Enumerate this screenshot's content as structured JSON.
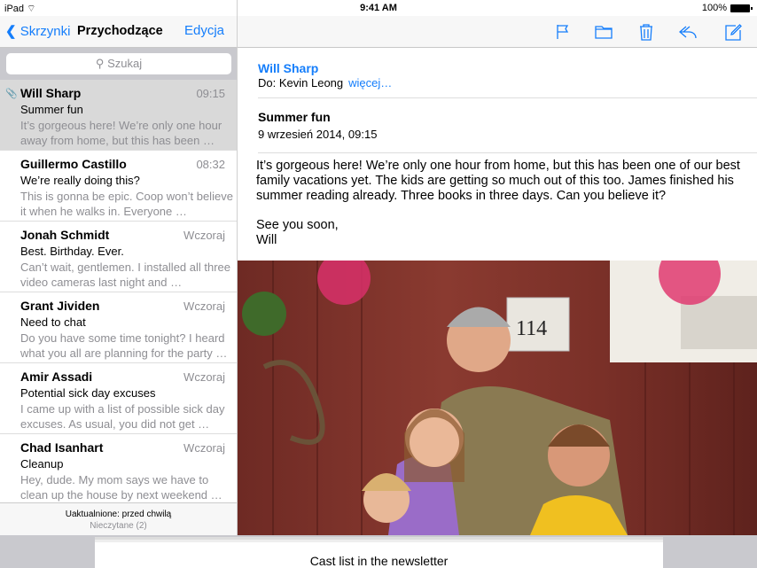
{
  "status": {
    "device": "iPad",
    "time": "9:41 AM",
    "battery": "100%"
  },
  "list": {
    "back_label": "Skrzynki",
    "title": "Przychodzące",
    "edit_label": "Edycja",
    "search_placeholder": "Szukaj",
    "messages": [
      {
        "from": "Will Sharp",
        "time": "09:15",
        "subject": "Summer fun",
        "preview": "It’s gorgeous here! We’re only one hour away from home, but this has been …",
        "attachment": true,
        "selected": true
      },
      {
        "from": "Guillermo Castillo",
        "time": "08:32",
        "subject": "We’re really doing this?",
        "preview": "This is gonna be epic. Coop won’t believe it when he walks in. Everyone …"
      },
      {
        "from": "Jonah Schmidt",
        "time": "Wczoraj",
        "subject": "Best. Birthday. Ever.",
        "preview": "Can’t wait, gentlemen. I installed all three video cameras last night and …"
      },
      {
        "from": "Grant Jividen",
        "time": "Wczoraj",
        "subject": "Need to chat",
        "preview": "Do you have some time tonight? I heard what you all are planning for the party …"
      },
      {
        "from": "Amir Assadi",
        "time": "Wczoraj",
        "subject": "Potential sick day excuses",
        "preview": "I came up with a list of possible sick day excuses. As usual, you did not get …"
      },
      {
        "from": "Chad Isanhart",
        "time": "Wczoraj",
        "subject": "Cleanup",
        "preview": "Hey, dude. My mom says we have to clean up the house by next weekend …"
      }
    ],
    "footer_updated": "Uaktualnione: przed chwilą",
    "footer_unread": "Nieczytane (2)"
  },
  "message": {
    "sender": "Will Sharp",
    "to_label": "Do:",
    "to": "Kevin Leong",
    "more": "więcej…",
    "subject": "Summer fun",
    "date": "9 wrzesień 2014, 09:15",
    "body": "It’s gorgeous here! We’re only one hour from home, but this has been one of our best family vacations yet. The kids are getting so much out of this too. James finished his summer reading already. Three books in three days. Can you believe it?",
    "closing": "See you soon,",
    "signature": "Will",
    "house_number": "114"
  },
  "draft": {
    "subject": "Cast list in the newsletter"
  },
  "colors": {
    "accent": "#157efb"
  }
}
